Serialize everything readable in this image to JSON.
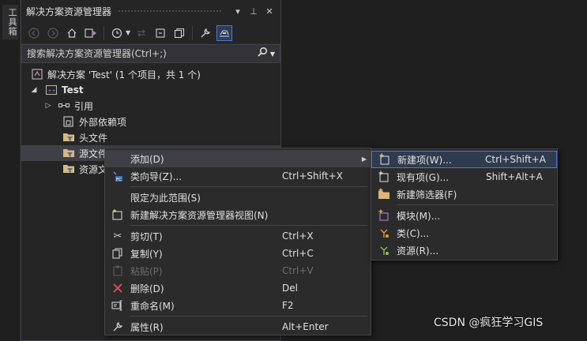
{
  "toolbox": {
    "label": "工具箱"
  },
  "explorer": {
    "title": "解决方案资源管理器",
    "title_buttons": {
      "dropdown": "▾",
      "pin": "⊥",
      "close": "✕"
    },
    "search_placeholder": "搜索解决方案资源管理器(Ctrl+;)",
    "tree": {
      "solution": "解决方案 'Test' (1 个项目，共 1 个)",
      "project": "Test",
      "references": "引用",
      "external_deps": "外部依赖项",
      "header_files": "头文件",
      "source_files": "源文件",
      "resource_files": "资源文"
    }
  },
  "context_menu": {
    "items": [
      {
        "label": "添加(D)",
        "shortcut": ""
      },
      {
        "label": "类向导(Z)...",
        "shortcut": "Ctrl+Shift+X"
      },
      {
        "label": "限定为此范围(S)",
        "shortcut": ""
      },
      {
        "label": "新建解决方案资源管理器视图(N)",
        "shortcut": ""
      },
      {
        "label": "剪切(T)",
        "shortcut": "Ctrl+X"
      },
      {
        "label": "复制(Y)",
        "shortcut": "Ctrl+C"
      },
      {
        "label": "粘贴(P)",
        "shortcut": "Ctrl+V"
      },
      {
        "label": "删除(D)",
        "shortcut": "Del"
      },
      {
        "label": "重命名(M)",
        "shortcut": "F2"
      },
      {
        "label": "属性(R)",
        "shortcut": "Alt+Enter"
      }
    ]
  },
  "submenu": {
    "items": [
      {
        "label": "新建项(W)...",
        "shortcut": "Ctrl+Shift+A"
      },
      {
        "label": "现有项(G)...",
        "shortcut": "Shift+Alt+A"
      },
      {
        "label": "新建筛选器(F)",
        "shortcut": ""
      },
      {
        "label": "模块(M)...",
        "shortcut": ""
      },
      {
        "label": "类(C)...",
        "shortcut": ""
      },
      {
        "label": "资源(R)...",
        "shortcut": ""
      }
    ]
  },
  "watermark": "CSDN @疯狂学习GIS",
  "colors": {
    "accent": "#4d78cc",
    "background": "#1f1f1f",
    "panel": "#252526",
    "menu": "#2b2b2b"
  }
}
